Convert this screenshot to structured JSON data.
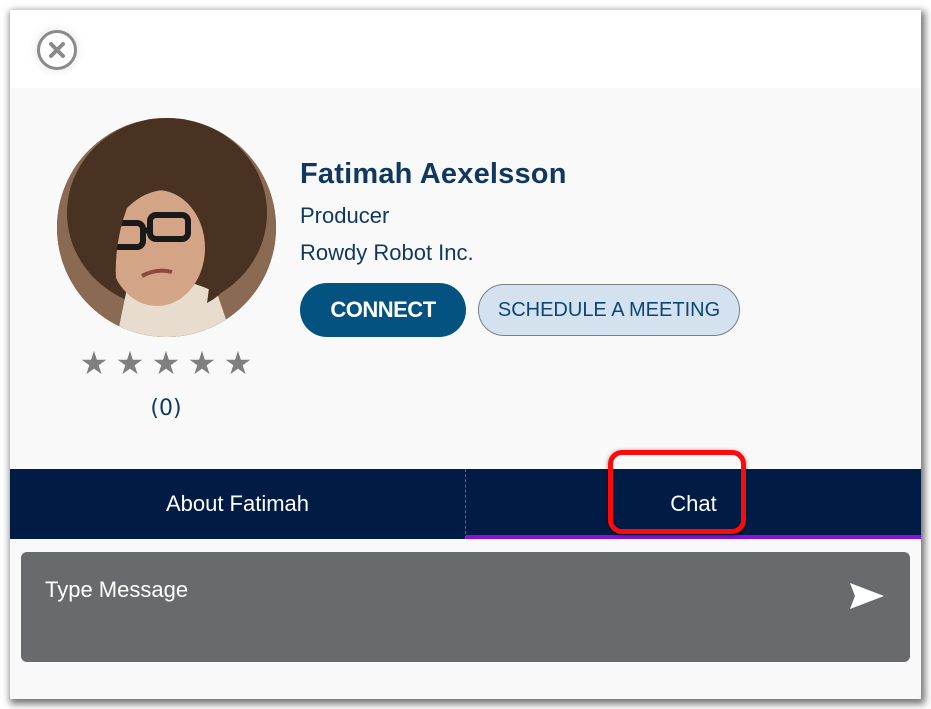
{
  "close": {
    "icon": "close-circle-icon"
  },
  "profile": {
    "name": "Fatimah Aexelsson",
    "title": "Producer",
    "company": "Rowdy Robot Inc.",
    "avatar_alt": "Profile photo of Fatimah Aexelsson",
    "rating": {
      "stars_total": 5,
      "stars_filled": 0,
      "count_label": "(0)"
    },
    "star_glyph": "★"
  },
  "actions": {
    "connect_label": "CONNECT",
    "schedule_label": "SCHEDULE A MEETING"
  },
  "tabs": [
    {
      "label": "About Fatimah",
      "active": false
    },
    {
      "label": "Chat",
      "active": true
    }
  ],
  "chat": {
    "placeholder": "Type Message",
    "value": "",
    "send_icon": "send-icon"
  },
  "colors": {
    "brand_navy": "#001c45",
    "connect_blue": "#03527f",
    "schedule_bg": "#d4e2f0",
    "active_tab_underline": "#8a10e0",
    "highlight_red": "#ff0a0a",
    "chat_bg": "#696a6e",
    "text_navy": "#10385f"
  }
}
